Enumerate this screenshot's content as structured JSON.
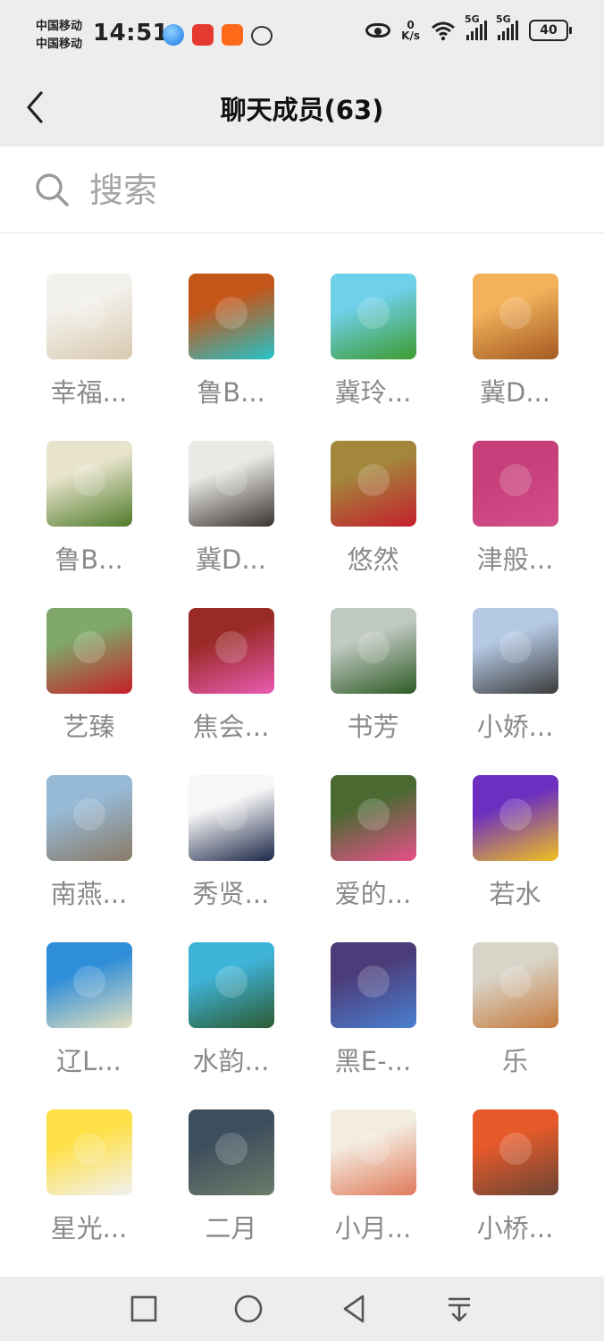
{
  "status_bar": {
    "carrier_1": "中国移动",
    "carrier_2": "中国移动",
    "time": "14:51",
    "net_speed_value": "0",
    "net_speed_unit": "K/s",
    "signal_1": "5G",
    "signal_2": "5G",
    "battery": "40"
  },
  "header": {
    "title": "聊天成员(63)"
  },
  "search": {
    "placeholder": "搜索"
  },
  "members": [
    {
      "name": "幸福...",
      "colors": [
        "#f3f1ec",
        "#d9c9b0"
      ]
    },
    {
      "name": "鲁B...",
      "colors": [
        "#c4561a",
        "#25c3c8"
      ]
    },
    {
      "name": "冀玲...",
      "colors": [
        "#6fd0ea",
        "#3d9b2e"
      ]
    },
    {
      "name": "冀D...",
      "colors": [
        "#f3b15a",
        "#a35a22"
      ]
    },
    {
      "name": "鲁B...",
      "colors": [
        "#e8e4cc",
        "#4f7a2a"
      ]
    },
    {
      "name": "冀D...",
      "colors": [
        "#e9e9e6",
        "#3a3330"
      ]
    },
    {
      "name": "悠然",
      "colors": [
        "#a3873b",
        "#c41f2d"
      ]
    },
    {
      "name": "津般...",
      "colors": [
        "#c63e7a",
        "#d34e8a"
      ]
    },
    {
      "name": "艺臻",
      "colors": [
        "#7fa86a",
        "#c71f28"
      ]
    },
    {
      "name": "焦会...",
      "colors": [
        "#9a2a25",
        "#e95bb2"
      ]
    },
    {
      "name": "书芳",
      "colors": [
        "#c0c9c2",
        "#2e5b25"
      ]
    },
    {
      "name": "小娇...",
      "colors": [
        "#b5c9e5",
        "#3b3b3b"
      ]
    },
    {
      "name": "南燕...",
      "colors": [
        "#96b9d6",
        "#8a7a66"
      ]
    },
    {
      "name": "秀贤...",
      "colors": [
        "#f7f7f7",
        "#1c2748"
      ]
    },
    {
      "name": "爱的...",
      "colors": [
        "#4a6a32",
        "#e8508a"
      ]
    },
    {
      "name": "若水",
      "colors": [
        "#6c2fc0",
        "#f0c020"
      ]
    },
    {
      "name": "辽L...",
      "colors": [
        "#2f8ed8",
        "#e6e1c0"
      ]
    },
    {
      "name": "水韵...",
      "colors": [
        "#3fb4d9",
        "#2c5a31"
      ]
    },
    {
      "name": "黑E-...",
      "colors": [
        "#4c3d7a",
        "#4a7fd0"
      ]
    },
    {
      "name": "乐",
      "colors": [
        "#d9d4c8",
        "#c57a3c"
      ]
    },
    {
      "name": "星光...",
      "colors": [
        "#ffe046",
        "#f1f1f1"
      ]
    },
    {
      "name": "二月",
      "colors": [
        "#3d4e5d",
        "#6b7b6a"
      ]
    },
    {
      "name": "小月...",
      "colors": [
        "#f3ece0",
        "#e07a5a"
      ]
    },
    {
      "name": "小桥...",
      "colors": [
        "#e65a2a",
        "#6a4535"
      ]
    }
  ],
  "accent_colors": {
    "header_bg": "#ededed",
    "name_text": "#8a8a8a"
  }
}
